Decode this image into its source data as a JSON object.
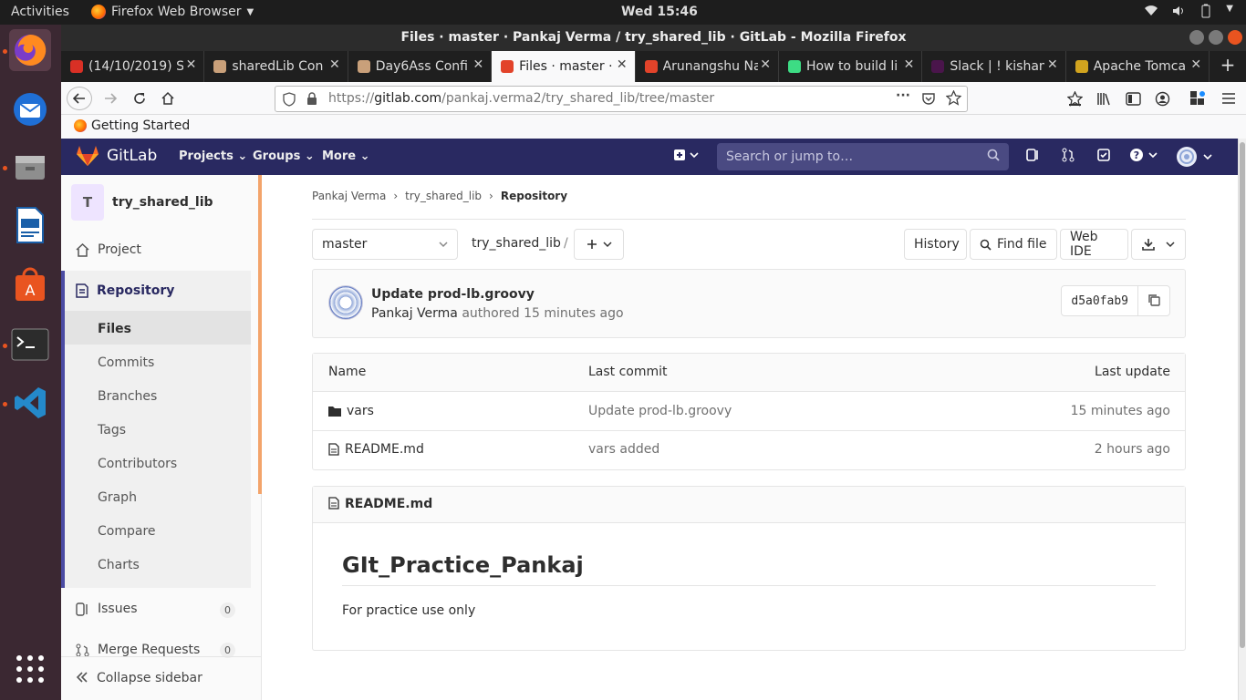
{
  "system": {
    "activities": "Activities",
    "app_name": "Firefox Web Browser",
    "clock": "Wed 15:46"
  },
  "window": {
    "title": "Files · master · Pankaj Verma / try_shared_lib · GitLab - Mozilla Firefox"
  },
  "tabs": [
    {
      "label": "(14/10/2019) S",
      "icon": "gmail-icon",
      "color": "#d93025"
    },
    {
      "label": "sharedLib Con",
      "icon": "jenkins-icon",
      "color": "#c9a07a"
    },
    {
      "label": "Day6Ass Confi",
      "icon": "jenkins-icon",
      "color": "#c9a07a"
    },
    {
      "label": "Files · master ·",
      "icon": "gitlab-icon",
      "color": "#e2432a"
    },
    {
      "label": "Arunangshu Na",
      "icon": "gitlab-icon",
      "color": "#e2432a"
    },
    {
      "label": "How to build li",
      "icon": "android-icon",
      "color": "#3ddc84"
    },
    {
      "label": "Slack | ! kishan",
      "icon": "slack-icon",
      "color": "#4a154b"
    },
    {
      "label": "Apache Tomca",
      "icon": "tomcat-icon",
      "color": "#d2a41f"
    }
  ],
  "url": {
    "prefix": "https://",
    "domain": "gitlab.com",
    "path": "/pankaj.verma2/try_shared_lib/tree/master"
  },
  "bookmarks": {
    "getting_started": "Getting Started"
  },
  "gitlab_nav": {
    "brand": "GitLab",
    "projects": "Projects",
    "groups": "Groups",
    "more": "More",
    "search_placeholder": "Search or jump to…"
  },
  "sidebar": {
    "avatar_letter": "T",
    "project_name": "try_shared_lib",
    "project": "Project",
    "repository": "Repository",
    "items": [
      "Files",
      "Commits",
      "Branches",
      "Tags",
      "Contributors",
      "Graph",
      "Compare",
      "Charts"
    ],
    "issues": "Issues",
    "issues_count": "0",
    "merge_requests": "Merge Requests",
    "merge_requests_count": "0",
    "collapse": "Collapse sidebar"
  },
  "breadcrumb": [
    "Pankaj Verma",
    "try_shared_lib",
    "Repository"
  ],
  "controls": {
    "branch": "master",
    "path": "try_shared_lib",
    "separator": "/",
    "history": "History",
    "find_file": "Find file",
    "web_ide": "Web IDE"
  },
  "commit": {
    "message": "Update prod-lb.groovy",
    "author": "Pankaj Verma",
    "authored": "authored 15 minutes ago",
    "sha": "d5a0fab9"
  },
  "table": {
    "headers": [
      "Name",
      "Last commit",
      "Last update"
    ],
    "rows": [
      {
        "name": "vars",
        "type": "folder",
        "commit": "Update prod-lb.groovy",
        "updated": "15 minutes ago"
      },
      {
        "name": "README.md",
        "type": "file",
        "commit": "vars added",
        "updated": "2 hours ago"
      }
    ]
  },
  "readme": {
    "filename": "README.md",
    "heading": "GIt_Practice_Pankaj",
    "body": "For practice use only"
  },
  "colors": {
    "gitlab_nav": "#292961",
    "accent": "#e95420",
    "sidebar_active": "#4b4ba3"
  }
}
